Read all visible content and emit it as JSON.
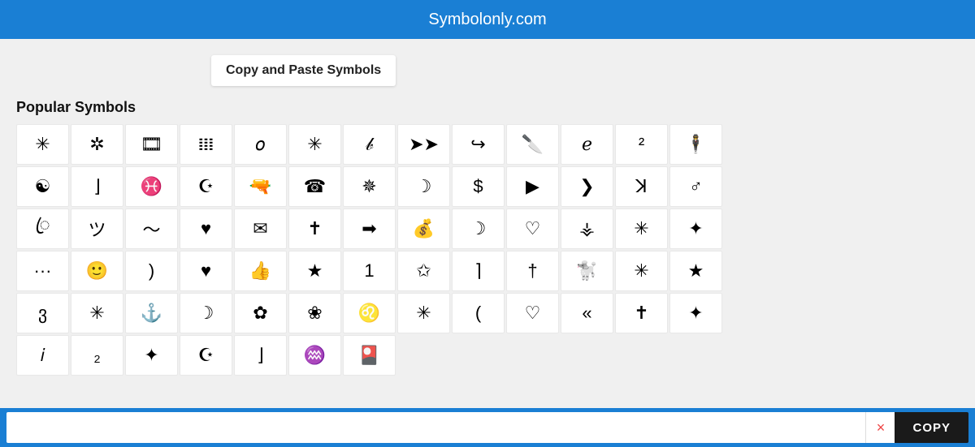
{
  "header": {
    "title": "Symbolonly.com"
  },
  "breadcrumb": {
    "label": "Copy and Paste Symbols"
  },
  "section": {
    "title": "Popular Symbols"
  },
  "symbols": [
    "✳",
    "✲",
    "🎞",
    "𝍖",
    "𝑜",
    "✳",
    "𝒷",
    "➤➤",
    "↪",
    "🔪",
    "ℯ",
    "²",
    "🕴",
    "☯",
    "⌋",
    "♓",
    "☪",
    "🔫",
    "☎",
    "✵",
    "☽",
    "$",
    "▶",
    "❯",
    "ꓘ",
    "♂",
    "ꦿ",
    "ツ",
    "〜",
    "♥",
    "✉",
    "✝",
    "➡",
    "💰",
    "☽",
    "♡",
    "⚶",
    "✳",
    "✦",
    "···",
    "🙂",
    ")",
    "♥",
    "👍",
    "★",
    "1",
    "✩",
    "⌉",
    "†",
    "🐩",
    "✳",
    "★",
    "ვ",
    "✳",
    "⚓",
    "☽",
    "✿",
    "❀",
    "♌",
    "✳",
    "(",
    "♡",
    "«",
    "✝",
    "✦",
    "𝑖",
    "₂",
    "✦",
    "☪",
    "⌋",
    "♒",
    "🎴"
  ],
  "bottom_bar": {
    "input_placeholder": "",
    "clear_label": "×",
    "copy_label": "COPY"
  }
}
